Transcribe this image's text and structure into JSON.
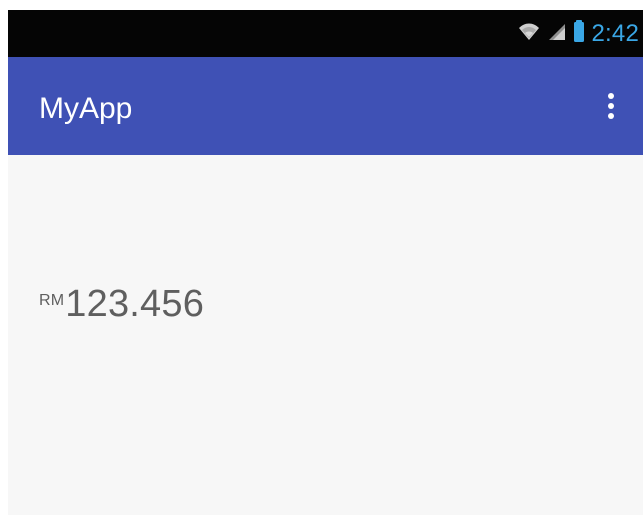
{
  "status_bar": {
    "time": "2:42",
    "icons": {
      "wifi": "wifi-icon",
      "signal": "signal-icon",
      "battery": "battery-icon"
    },
    "colors": {
      "background": "#050505",
      "accent": "#3aa7e6"
    }
  },
  "app_bar": {
    "title": "MyApp",
    "overflow_icon": "overflow-menu-icon",
    "background_color": "#3f51b5"
  },
  "content": {
    "amount": {
      "currency": "RM",
      "value": "123.456"
    },
    "background_color": "#f7f7f7"
  }
}
